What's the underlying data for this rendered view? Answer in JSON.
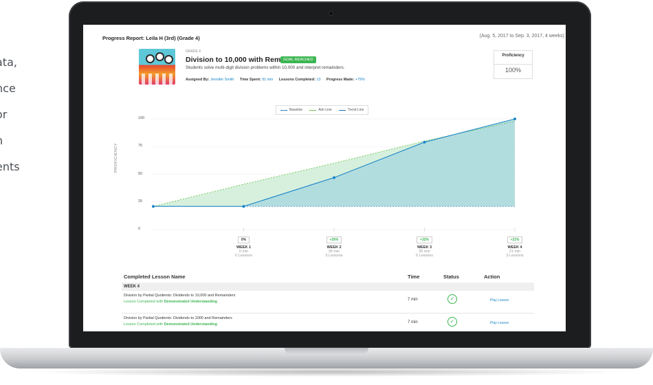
{
  "side_text": [
    "ata,",
    "nce",
    "or",
    "n",
    "ents"
  ],
  "report": {
    "title": "Progress Report: Leila H (3rd) (Grade 4)",
    "date_range": "(Aug. 5, 2017 to Sep. 3, 2017, 4 weeks)"
  },
  "lesson": {
    "grade": "GRADE 4",
    "title": "Division to 10,000 with Remainders",
    "goal_badge": "GOAL REACHED",
    "description": "Students solve multi-digit division problems within 10,000 and interpret remainders.",
    "assigned_by_label": "Assigned By:",
    "assigned_by": "Jennifer Smith",
    "time_spent_label": "Time Spent:",
    "time_spent": "91 min",
    "lessons_completed_label": "Lessons Completed:",
    "lessons_completed": "13",
    "progress_made_label": "Progress Made:",
    "progress_made": "+79%"
  },
  "proficiency": {
    "label": "Proficiency",
    "value": "100%"
  },
  "chart_data": {
    "type": "line",
    "ylabel": "PROFICIENCY",
    "ylim": [
      0,
      100
    ],
    "yticks": [
      0,
      25,
      50,
      75,
      100
    ],
    "x": [
      0,
      1,
      2,
      3,
      4
    ],
    "series": [
      {
        "name": "Baseline",
        "values": [
          21,
          21,
          21,
          21,
          21
        ]
      },
      {
        "name": "Aim Line",
        "values": [
          21,
          41,
          60,
          80,
          98
        ]
      },
      {
        "name": "Trend Line",
        "values": [
          21,
          21,
          47,
          79,
          100
        ]
      }
    ],
    "legend": [
      "Baseline",
      "Aim Line",
      "Trend Line"
    ],
    "legend_position": "top-center",
    "colors": {
      "trend": "#1a86c8",
      "aim": "#5bbf3d",
      "baseline": "#1a6fb5",
      "fill": "#bfe3dc"
    }
  },
  "weeks": [
    {
      "badge": "0%",
      "name": "WEEK 1",
      "time": "0 min",
      "lessons": "0 Lessons"
    },
    {
      "badge": "+26%",
      "name": "WEEK 2",
      "time": "35 min",
      "lessons": "5 Lessons"
    },
    {
      "badge": "+32%",
      "name": "WEEK 3",
      "time": "35 min",
      "lessons": "5 Lessons"
    },
    {
      "badge": "+21%",
      "name": "WEEK 4",
      "time": "21 min",
      "lessons": "3 Lessons"
    }
  ],
  "table": {
    "headers": {
      "name": "Completed Lesson Name",
      "time": "Time",
      "status": "Status",
      "action": "Action"
    },
    "week_label": "WEEK 4",
    "rows": [
      {
        "name": "Division by Partial Quotients: Dividends to 10,000 and Remainders",
        "status_prefix": "Lesson Completed with",
        "status_strong": "Demonstrated Understanding",
        "time": "7 min",
        "action": "Play Lesson"
      },
      {
        "name": "Division by Partial Quotients: Dividends to 1000 and Remainders",
        "status_prefix": "Lesson Completed with",
        "status_strong": "Demonstrated Understanding",
        "time": "7 min",
        "action": "Play Lesson"
      }
    ]
  }
}
